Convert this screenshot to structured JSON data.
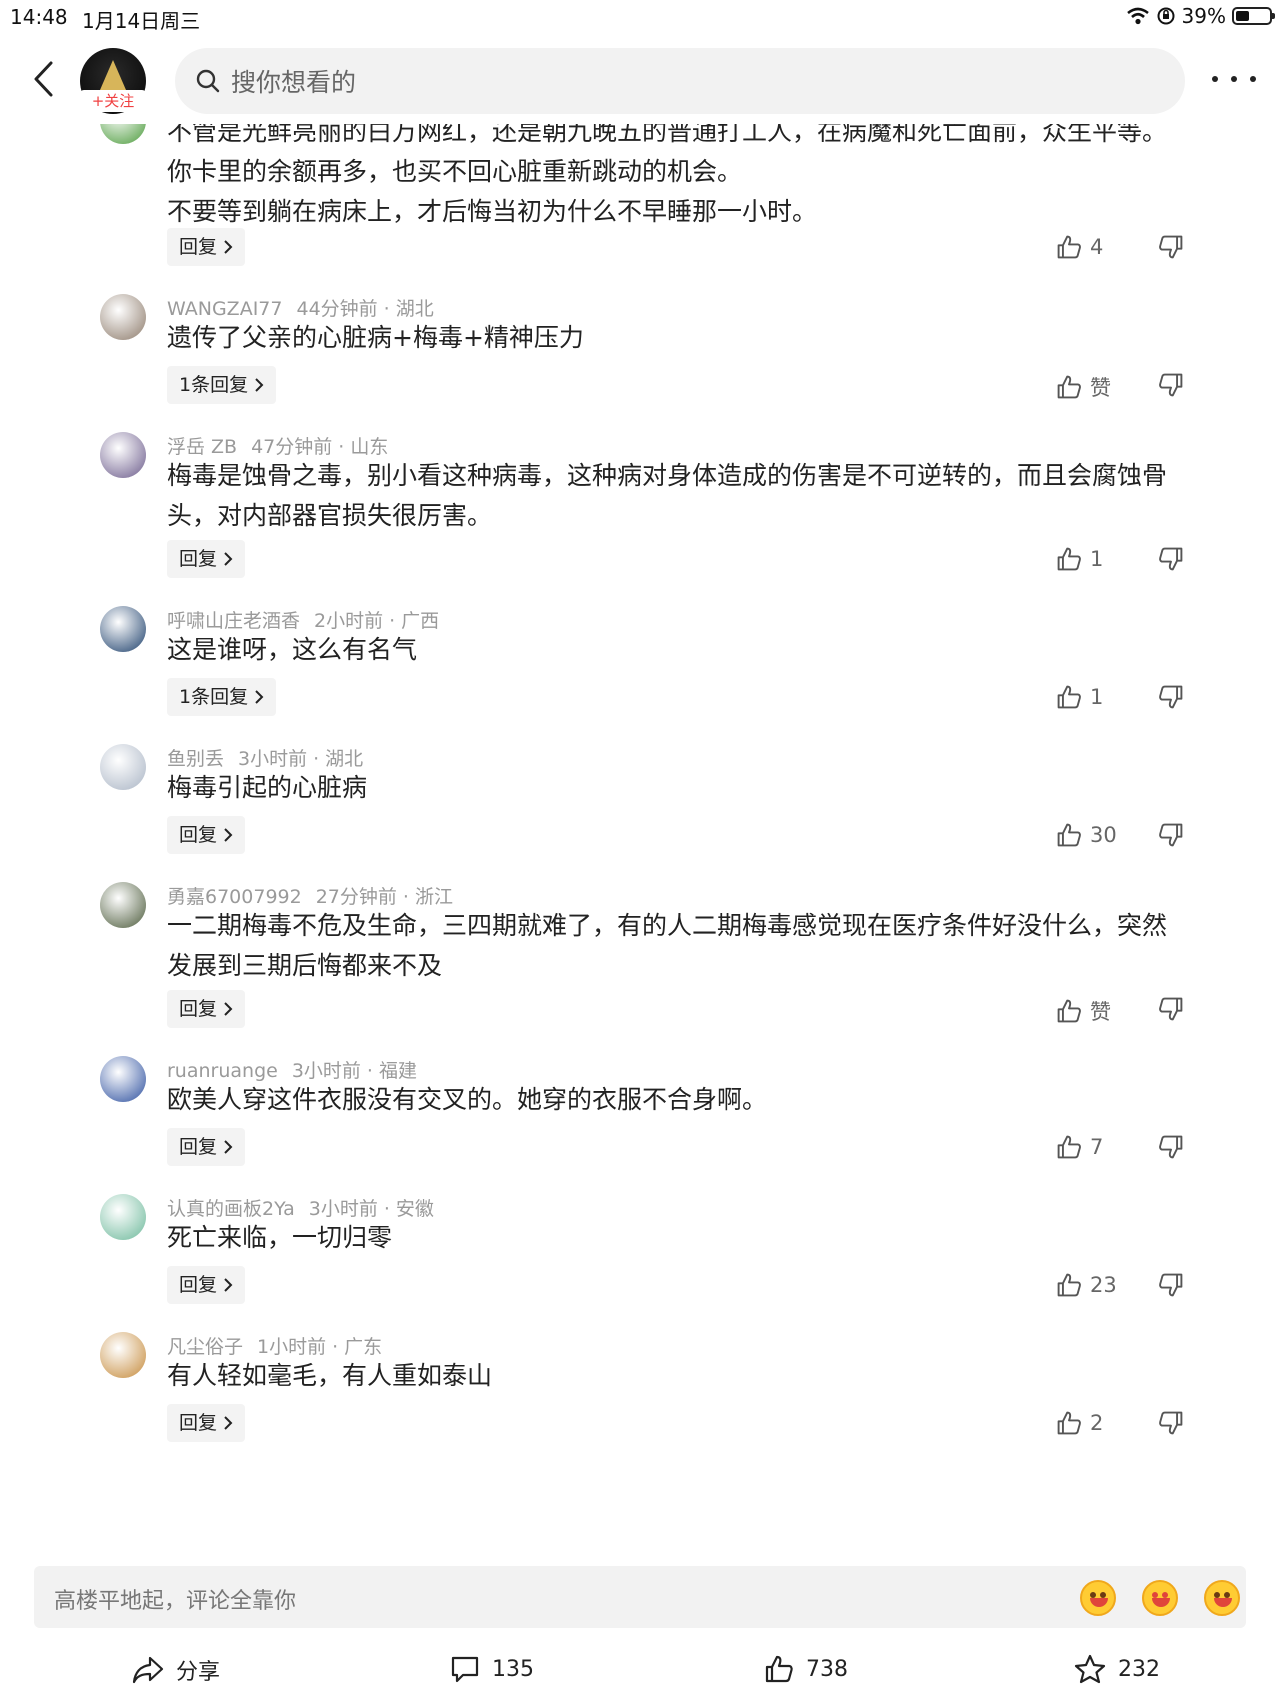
{
  "status_bar": {
    "time": "14:48",
    "date": "1月14日周三",
    "battery": "39%"
  },
  "header": {
    "follow_label": "+关注",
    "search_placeholder": "搜你想看的"
  },
  "comments": [
    {
      "user": "",
      "time": "",
      "region": "",
      "text": "不管是光鲜亮丽的白万网红，还是朝九晚五的普通打工人，在病魔和死亡面前，众生平等。你卡里的余额再多，也买不回心脏重新跳动的机会。\n不要等到躺在病床上，才后悔当初为什么不早睡那一小时。",
      "reply": "回复",
      "likes": "4",
      "avatar_color": "#4a9a3a"
    },
    {
      "user": "WANGZAI77",
      "time": "44分钟前",
      "region": "湖北",
      "text": "遗传了父亲的心脏病+梅毒+精神压力",
      "reply": "1条回复",
      "likes": "赞",
      "avatar_color": "#8c7a6a"
    },
    {
      "user": "浮岳 ZB",
      "time": "47分钟前",
      "region": "山东",
      "text": "梅毒是蚀骨之毒，别小看这种病毒，这种病对身体造成的伤害是不可逆转的，而且会腐蚀骨头，对内部器官损失很厉害。",
      "reply": "回复",
      "likes": "1",
      "avatar_color": "#6a5a8a"
    },
    {
      "user": "呼啸山庄老酒香",
      "time": "2小时前",
      "region": "广西",
      "text": "这是谁呀，这么有名气",
      "reply": "1条回复",
      "likes": "1",
      "avatar_color": "#1c3f6b"
    },
    {
      "user": "鱼别丢",
      "time": "3小时前",
      "region": "湖北",
      "text": "梅毒引起的心脏病",
      "reply": "回复",
      "likes": "30",
      "avatar_color": "#a9b4c4"
    },
    {
      "user": "勇嘉67007992",
      "time": "27分钟前",
      "region": "浙江",
      "text": "一二期梅毒不危及生命，三四期就难了，有的人二期梅毒感觉现在医疗条件好没什么，突然发展到三期后悔都来不及",
      "reply": "回复",
      "likes": "赞",
      "avatar_color": "#4b5a3a"
    },
    {
      "user": "ruanruange",
      "time": "3小时前",
      "region": "福建",
      "text": "欧美人穿这件衣服没有交叉的。她穿的衣服不合身啊。",
      "reply": "回复",
      "likes": "7",
      "avatar_color": "#2c4f9e"
    },
    {
      "user": "认真的画板2Ya",
      "time": "3小时前",
      "region": "安徽",
      "text": "死亡来临，一切归零",
      "reply": "回复",
      "likes": "23",
      "avatar_color": "#6cb89a"
    },
    {
      "user": "凡尘俗子",
      "time": "1小时前",
      "region": "广东",
      "text": "有人轻如毫毛，有人重如泰山",
      "reply": "回复",
      "likes": "2",
      "avatar_color": "#c58a3a"
    }
  ],
  "footer": {
    "input_placeholder": "高楼平地起，评论全靠你",
    "share_label": "分享",
    "comment_count": "135",
    "like_count": "738",
    "favorite_count": "232"
  }
}
